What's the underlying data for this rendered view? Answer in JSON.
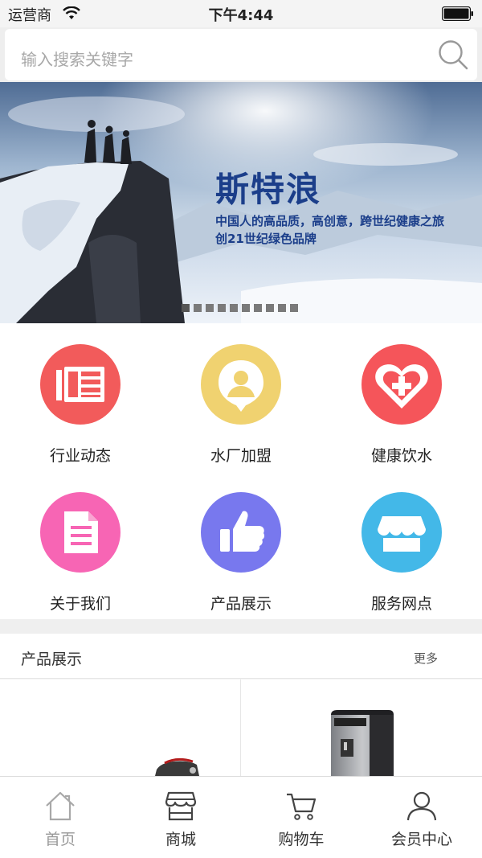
{
  "status_bar": {
    "carrier": "运营商",
    "time": "下午4:44"
  },
  "search": {
    "placeholder": "输入搜索关键字"
  },
  "banner": {
    "title": "斯特浪",
    "subtitle_line1": "中国人的高品质，高创意，跨世纪健康之旅",
    "subtitle_line2": "创21世纪绿色品牌",
    "slide_count": 10,
    "active_slide": 1
  },
  "grid": {
    "items": [
      {
        "label": "行业动态",
        "icon": "news-icon",
        "color": "#f25b5b"
      },
      {
        "label": "水厂加盟",
        "icon": "person-icon",
        "color": "#f0d270"
      },
      {
        "label": "健康饮水",
        "icon": "heart-plus-icon",
        "color": "#f5555a"
      },
      {
        "label": "关于我们",
        "icon": "document-icon",
        "color": "#f765b4"
      },
      {
        "label": "产品展示",
        "icon": "thumbs-up-icon",
        "color": "#7878ee"
      },
      {
        "label": "服务网点",
        "icon": "store-icon",
        "color": "#43b8e8"
      }
    ]
  },
  "products_section": {
    "title": "产品展示",
    "more": "更多"
  },
  "tab_bar": {
    "tabs": [
      {
        "label": "首页",
        "icon": "home-icon",
        "active": true
      },
      {
        "label": "商城",
        "icon": "shop-icon",
        "active": false
      },
      {
        "label": "购物车",
        "icon": "cart-icon",
        "active": false
      },
      {
        "label": "会员中心",
        "icon": "user-icon",
        "active": false
      }
    ]
  }
}
